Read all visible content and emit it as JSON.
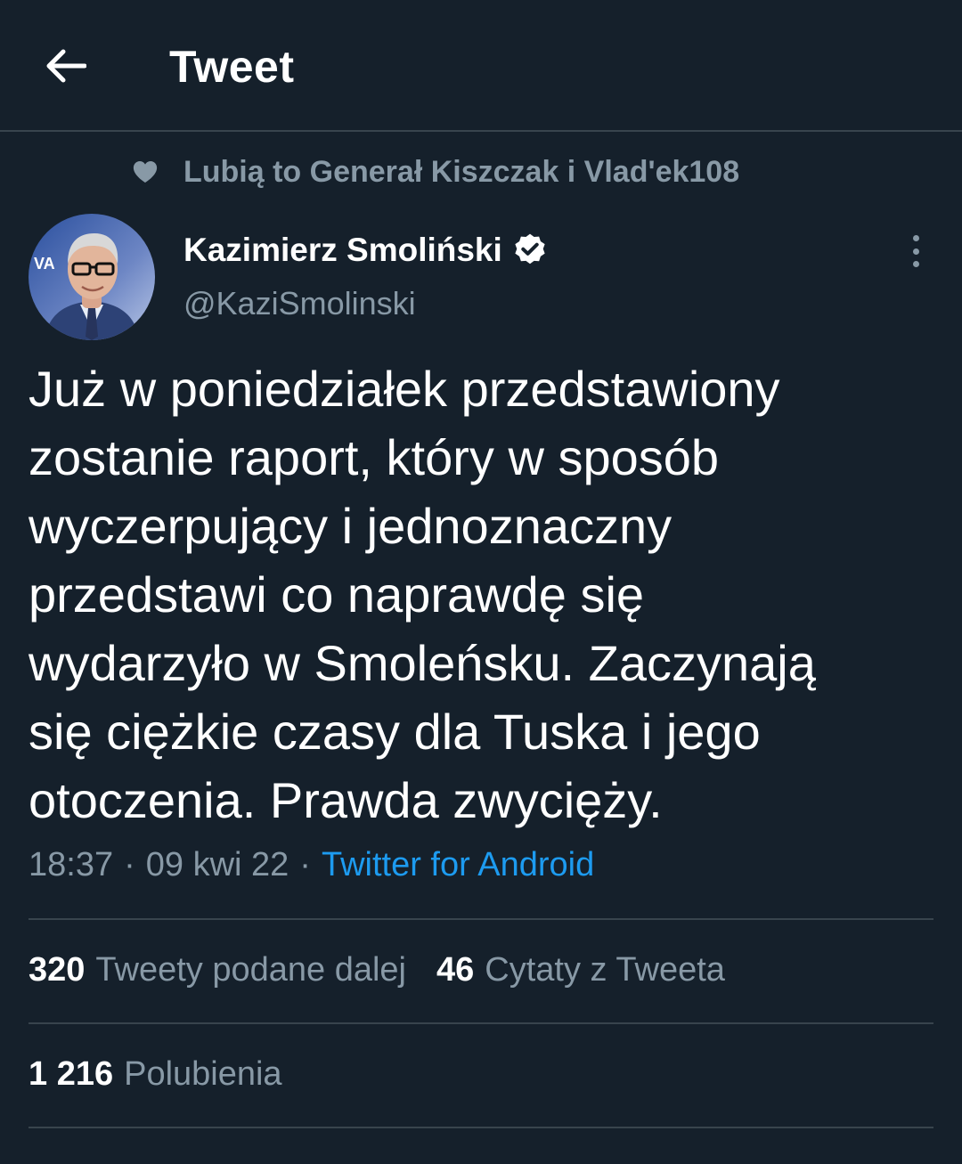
{
  "header": {
    "title": "Tweet",
    "back_icon": "arrow-left-icon"
  },
  "social_context": {
    "text": "Lubią to Generał Kiszczak i Vlad'ek108",
    "icon": "heart-icon"
  },
  "author": {
    "name": "Kazimierz Smoliński",
    "handle": "@KaziSmolinski",
    "verified": true,
    "avatar_badge_text": "VA"
  },
  "tweet": {
    "text": "Już w poniedziałek przedstawiony\nzostanie raport, który w sposób\nwyczerpujący i jednoznaczny\nprzedstawi co naprawdę się\nwydarzyło w Smoleńsku. Zaczynają\nsię ciężkie czasy dla Tuska i jego\notoczenia. Prawda zwycięży."
  },
  "meta": {
    "time": "18:37",
    "separator": "·",
    "date": "09 kwi 22",
    "source": "Twitter for Android"
  },
  "stats": {
    "retweets": {
      "count": "320",
      "label": "Tweety podane dalej"
    },
    "quotes": {
      "count": "46",
      "label": "Cytaty z Tweeta"
    },
    "likes": {
      "count": "1 216",
      "label": "Polubienia"
    }
  },
  "colors": {
    "background": "#15202b",
    "secondary_text": "#8899a6",
    "link": "#1d9bf0",
    "divider": "#38444d"
  }
}
